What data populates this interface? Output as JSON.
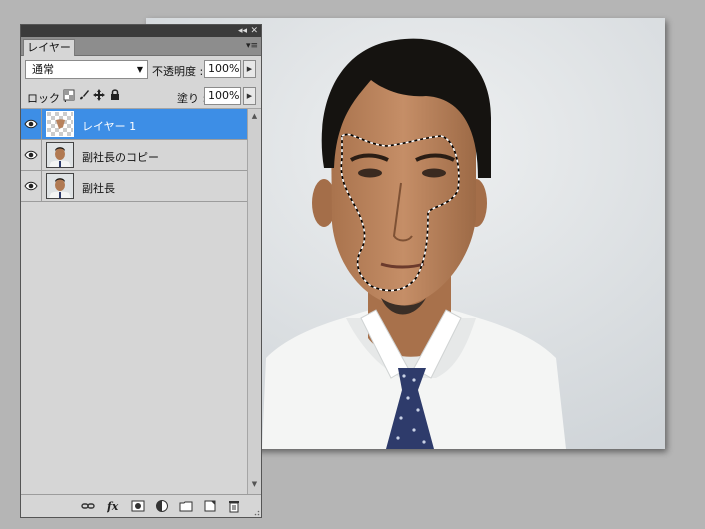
{
  "panel": {
    "tab_label": "レイヤー",
    "collapse_glyph": "◂◂",
    "close_glyph": "✕",
    "menu_glyph": "▾≡",
    "blend_mode": "通常",
    "opacity_label": "不透明度 :",
    "opacity_value": "100%",
    "lock_label": "ロック :",
    "fill_label": "塗り :",
    "fill_value": "100%",
    "layers": [
      {
        "name": "レイヤー 1",
        "visible": true,
        "selected": true
      },
      {
        "name": "副社長のコピー",
        "visible": true,
        "selected": false
      },
      {
        "name": "副社長",
        "visible": true,
        "selected": false
      }
    ],
    "bottom_icons": [
      "link-layers-icon",
      "fx-icon",
      "add-mask-icon",
      "adjustment-layer-icon",
      "new-group-icon",
      "new-layer-icon",
      "trash-icon"
    ]
  },
  "colors": {
    "selection_highlight": "#3d8ee6",
    "panel_bg": "#d6d6d6",
    "workspace_bg": "#b5b5b5",
    "shirt": "#f4f5f4",
    "tie": "#2e3b6b"
  }
}
